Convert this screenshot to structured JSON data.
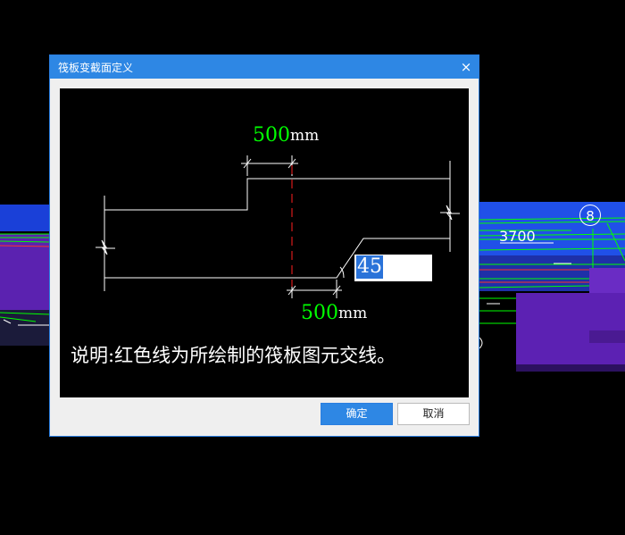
{
  "background": {
    "grid_label": "3700",
    "axis_marker": "8",
    "colors": {
      "blue": "#2050e8",
      "purple": "#5c21b3",
      "green_lines": "#00ff00"
    }
  },
  "dialog": {
    "title": "筏板变截面定义",
    "close_icon": "×",
    "diagram": {
      "top_dim_value": "500",
      "top_dim_unit": "mm",
      "bottom_dim_value": "500",
      "bottom_dim_unit": "mm",
      "angle_value": "45",
      "note": "说明:红色线为所绘制的筏板图元交线。",
      "colors": {
        "line": "#ffffff",
        "section_line": "#ff2020",
        "dim_value": "#00ff00"
      }
    },
    "buttons": {
      "ok_label": "确定",
      "cancel_label": "取消"
    }
  }
}
